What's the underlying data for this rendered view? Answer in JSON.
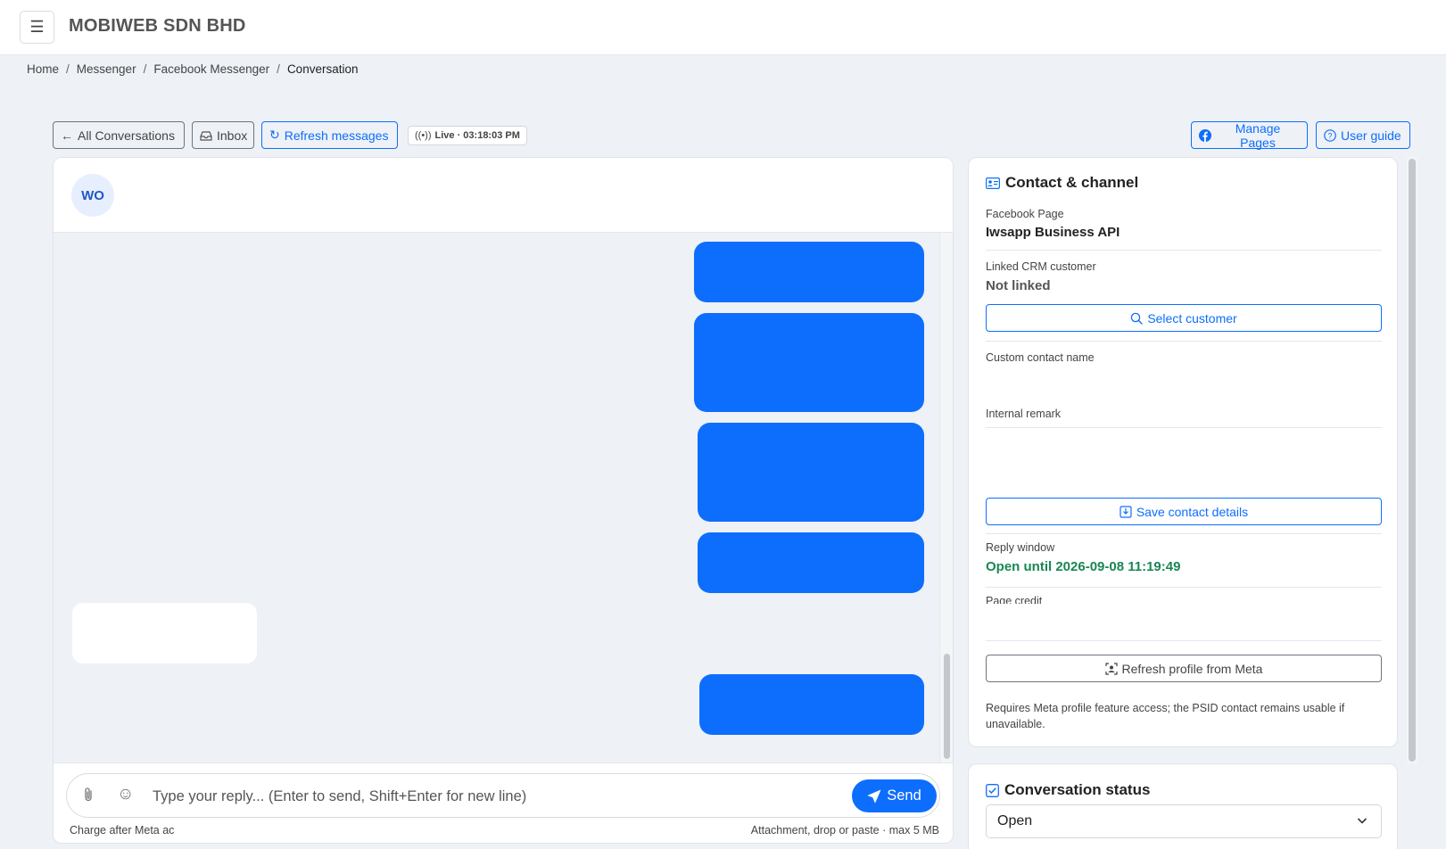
{
  "header": {
    "company": "MOBIWEB SDN BHD"
  },
  "breadcrumb": [
    "Home",
    "Messenger",
    "Facebook Messenger",
    "Conversation"
  ],
  "toolbar": {
    "all_conversations": "All Conversations",
    "inbox": "Inbox",
    "refresh_messages": "Refresh messages",
    "live": "Live · 03:18:03 PM",
    "manage_pages": "Manage Pages",
    "user_guide": "User guide"
  },
  "conversation": {
    "avatar_initials": "WO",
    "composer_placeholder": "Type your reply... (Enter to send, Shift+Enter for new line)",
    "send_label": "Send",
    "charge_note": "Charge after Meta ac",
    "attachment_hint": "Attachment, drop or paste · max 5 MB"
  },
  "contact": {
    "title": "Contact & channel",
    "facebook_page_label": "Facebook Page",
    "facebook_page_value": "Iwsapp Business API",
    "linked_crm_label": "Linked CRM customer",
    "linked_crm_value": "Not linked",
    "select_customer": "Select customer",
    "custom_name_label": "Custom contact name",
    "internal_remark_label": "Internal remark",
    "save_contact": "Save contact details",
    "reply_window_label": "Reply window",
    "reply_window_value": "Open until 2026-09-08 11:19:49",
    "page_credit_label": "Page credit",
    "refresh_profile": "Refresh profile from Meta",
    "profile_note": "Requires Meta profile feature access; the PSID contact remains usable if unavailable."
  },
  "status": {
    "title": "Conversation status",
    "value": "Open"
  },
  "colors": {
    "accent": "#0d6efd",
    "success": "#198754"
  }
}
